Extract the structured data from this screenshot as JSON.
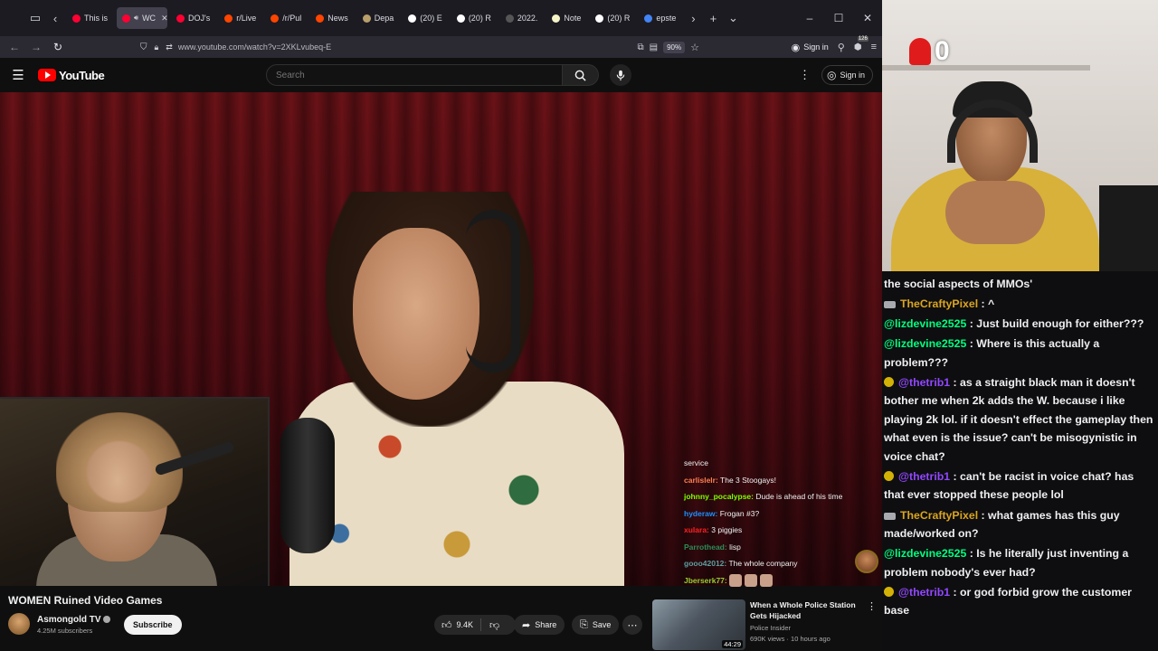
{
  "browser": {
    "tabs": [
      {
        "label": "This is",
        "favicon_color": "#ff0033",
        "active": false
      },
      {
        "label": "WC",
        "favicon_color": "#ff0033",
        "active": true
      },
      {
        "label": "DOJ's",
        "favicon_color": "#ff0033",
        "active": false
      },
      {
        "label": "r/Live",
        "favicon_color": "#ff4500",
        "active": false
      },
      {
        "label": "/r/Pul",
        "favicon_color": "#ff4500",
        "active": false
      },
      {
        "label": "News",
        "favicon_color": "#ff4500",
        "active": false
      },
      {
        "label": "Depa",
        "favicon_color": "#b8a06a",
        "active": false
      },
      {
        "label": "(20) E",
        "favicon_color": "#ffffff",
        "active": false
      },
      {
        "label": "(20) R",
        "favicon_color": "#ffffff",
        "active": false
      },
      {
        "label": "2022.",
        "favicon_color": "#555555",
        "active": false
      },
      {
        "label": "Note",
        "favicon_color": "#f5f5c8",
        "active": false
      },
      {
        "label": "(20) R",
        "favicon_color": "#ffffff",
        "active": false
      },
      {
        "label": "epste",
        "favicon_color": "#4285f4",
        "active": false
      }
    ],
    "url": "www.youtube.com/watch?v=2XKLvubeq-E",
    "zoom": "90%",
    "signin_label": "Sign in",
    "extension_badge": "126"
  },
  "youtube": {
    "logo_text": "YouTube",
    "search_placeholder": "Search",
    "signin_label": "Sign in"
  },
  "video": {
    "title": "WOMEN Ruined Video Games",
    "channel": "Asmongold TV",
    "subscribers": "4.25M subscribers",
    "subscribe_label": "Subscribe",
    "likes": "9.4K",
    "share_label": "Share",
    "save_label": "Save"
  },
  "overlay_chat": [
    {
      "user": "",
      "text": "service",
      "color": "#e0e0e0"
    },
    {
      "user": "carlislelr:",
      "text": "The 3 Stoogays!",
      "color": "#ff7f50"
    },
    {
      "user": "johnny_pocalypse:",
      "text": "Dude is ahead of his time",
      "color": "#7fff00"
    },
    {
      "user": "hyderaw:",
      "text": "Frogan #3?",
      "color": "#1e90ff"
    },
    {
      "user": "xulara:",
      "text": "3 piggies",
      "color": "#ff2020"
    },
    {
      "user": "Parrothead:",
      "text": "lisp",
      "color": "#2e8b57"
    },
    {
      "user": "gooo42012:",
      "text": "The whole company",
      "color": "#5f9ea0"
    },
    {
      "user": "Jberserk77:",
      "text": "",
      "color": "#9acd32"
    }
  ],
  "recommendation": {
    "title": "When a Whole Police Station Gets Hijacked",
    "channel": "Police Insider",
    "meta": "690K views · 10 hours ago",
    "duration": "44:29"
  },
  "webcam": {
    "counter": "0"
  },
  "chat": [
    {
      "icon": "",
      "user": "",
      "text": "the social aspects of MMOs'",
      "user_color": "#efeff1"
    },
    {
      "icon": "controller",
      "user": "TheCraftyPixel",
      "text": " : ^",
      "user_color": "#daa520"
    },
    {
      "icon": "",
      "user": "@lizdevine2525",
      "text": " : Just build enough for either???",
      "user_color": "#00ff7f"
    },
    {
      "icon": "",
      "user": "@lizdevine2525",
      "text": " : Where is this actually a problem???",
      "user_color": "#00ff7f"
    },
    {
      "icon": "star",
      "user": "@thetrib1",
      "text": " : as a straight black man it doesn't bother me when 2k adds the W. because i like playing 2k lol. if it doesn't effect the gameplay then what even is the issue? can't be misogynistic in voice chat?",
      "user_color": "#9147ff"
    },
    {
      "icon": "star",
      "user": "@thetrib1",
      "text": " : can't be racist in voice chat? has that ever stopped these people lol",
      "user_color": "#9147ff"
    },
    {
      "icon": "controller",
      "user": "TheCraftyPixel",
      "text": " : what games has this guy made/worked on?",
      "user_color": "#daa520"
    },
    {
      "icon": "",
      "user": "@lizdevine2525",
      "text": " : Is he literally just inventing a problem nobody's ever had?",
      "user_color": "#00ff7f"
    },
    {
      "icon": "star",
      "user": "@thetrib1",
      "text": " : or god forbid grow the customer base",
      "user_color": "#9147ff"
    }
  ]
}
